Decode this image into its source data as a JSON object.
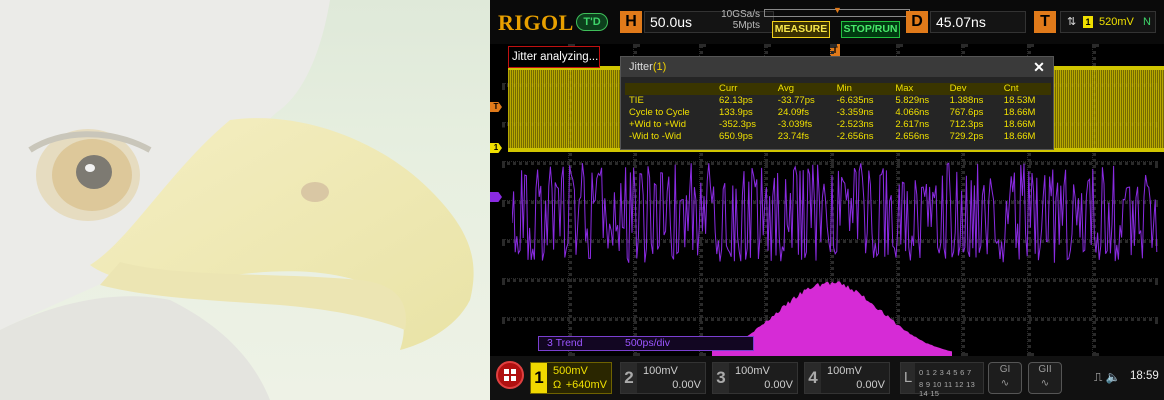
{
  "background": {
    "image": "bald-eagle-head"
  },
  "header": {
    "logo": "RIGOL",
    "mode_badge": "T'D",
    "horizontal": {
      "key": "H",
      "timebase": "50.0us",
      "sample_rate": "10GSa/s",
      "memory_depth": "5Mpts"
    },
    "measure_button": "MEASURE",
    "stop_run_button": "STOP/RUN",
    "delay": {
      "key": "D",
      "value": "45.07ns"
    },
    "trigger": {
      "key": "T",
      "edge_icon": "rising-falling-edge-icon",
      "channel": "1",
      "level": "520mV",
      "mode": "N"
    }
  },
  "status_label": "Jitter analyzing...",
  "jitter_window": {
    "title": "Jitter",
    "title_channel": "(1)",
    "close_label": "✕",
    "columns": [
      "",
      "Curr",
      "Avg",
      "Min",
      "Max",
      "Dev",
      "Cnt"
    ],
    "rows": [
      [
        "TIE",
        "62.13ps",
        "-33.77ps",
        "-6.635ns",
        "5.829ns",
        "1.388ns",
        "18.53M"
      ],
      [
        "Cycle to Cycle",
        "133.9ps",
        "24.09fs",
        "-3.359ns",
        "4.066ns",
        "767.6ps",
        "18.66M"
      ],
      [
        "+Wid to +Wid",
        "-352.3ps",
        "-3.039fs",
        "-2.523ns",
        "2.617ns",
        "712.3ps",
        "18.66M"
      ],
      [
        "-Wid to -Wid",
        "650.9ps",
        "23.74fs",
        "-2.656ns",
        "2.656ns",
        "729.2ps",
        "18.66M"
      ]
    ]
  },
  "channel_markers": {
    "trigger_level": "T",
    "ch1_top": "1",
    "ch1_bottom": "1"
  },
  "trend": {
    "label": "3 Trend",
    "scale": "500ps/div"
  },
  "colors": {
    "ch1": "#f0e000",
    "trend": "#8a2be2",
    "histogram": "#d62bd6",
    "accent_orange": "#e07a1a",
    "stop_run_green": "#22c040"
  },
  "bottom": {
    "ch1": {
      "number": "1",
      "scale": "500mV",
      "coupling": "Ω",
      "offset": "+640mV"
    },
    "ch2": {
      "number": "2",
      "scale": "100mV",
      "offset": "0.00V"
    },
    "ch3": {
      "number": "3",
      "scale": "100mV",
      "offset": "0.00V"
    },
    "ch4": {
      "number": "4",
      "scale": "100mV",
      "offset": "0.00V"
    },
    "logic": {
      "key": "L",
      "row1": "0 1 2 3  4 5 6 7",
      "row2": "8 9 10 11 12 13 14 15"
    },
    "g1": "GI",
    "g2": "GII",
    "time": "18:59"
  }
}
